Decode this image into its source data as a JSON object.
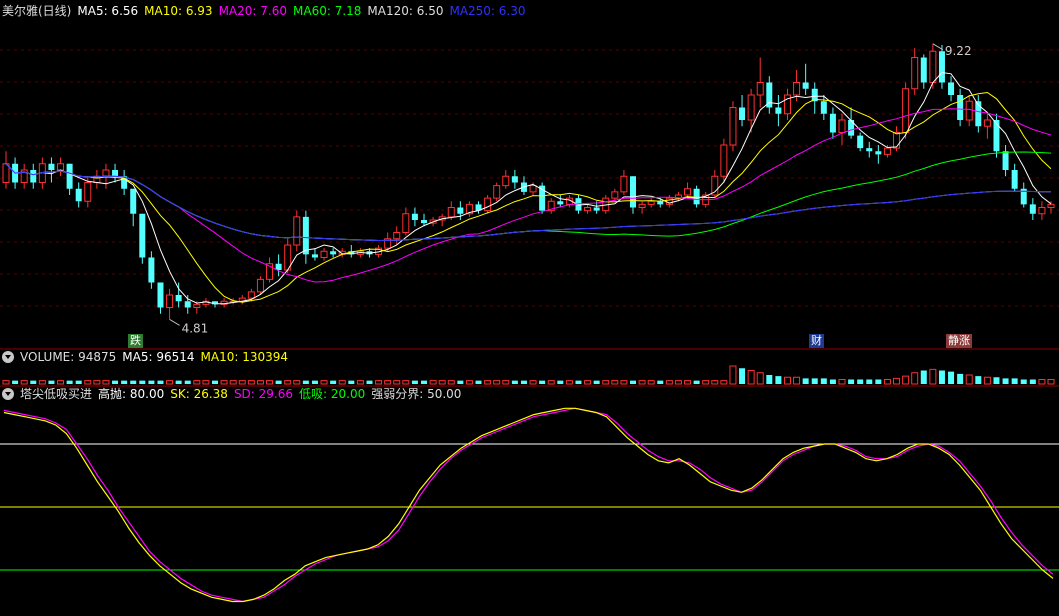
{
  "main": {
    "title": "美尔雅(日线)",
    "ma_labels": [
      {
        "text": "MA5: 6.56",
        "color": "#ffffff"
      },
      {
        "text": "MA10: 6.93",
        "color": "#ffff00"
      },
      {
        "text": "MA20: 7.60",
        "color": "#ff00ff"
      },
      {
        "text": "MA60: 7.18",
        "color": "#00ff00"
      },
      {
        "text": "MA120: 6.50",
        "color": "#dddddd"
      },
      {
        "text": "MA250: 6.30",
        "color": "#3030ff"
      }
    ],
    "high_label": "9.22",
    "low_label": "4.81",
    "tags": [
      {
        "text": "跌",
        "bg": "#2e7d32"
      },
      {
        "text": "财",
        "bg": "#1f3a93"
      },
      {
        "text": "静涨",
        "bg": "#8b3a3a"
      }
    ]
  },
  "volume": {
    "labels": [
      {
        "text": "VOLUME: 94875",
        "color": "#dddddd"
      },
      {
        "text": "MA5: 96514",
        "color": "#ffffff"
      },
      {
        "text": "MA10: 130394",
        "color": "#ffff00"
      }
    ]
  },
  "indicator": {
    "labels": [
      {
        "text": "塔尖低吸买进",
        "color": "#dddddd"
      },
      {
        "text": "高抛: 80.00",
        "color": "#ffffff"
      },
      {
        "text": "SK: 26.38",
        "color": "#ffff00"
      },
      {
        "text": "SD: 29.66",
        "color": "#ff00ff"
      },
      {
        "text": "低吸: 20.00",
        "color": "#00ff00"
      },
      {
        "text": "强弱分界: 50.00",
        "color": "#dddddd"
      }
    ]
  },
  "chart_data": {
    "type": "candlestick",
    "price_range": [
      4.4,
      9.6
    ],
    "candles": [
      [
        7.0,
        7.5,
        6.9,
        7.3
      ],
      [
        7.3,
        7.4,
        6.9,
        7.0
      ],
      [
        7.0,
        7.3,
        6.9,
        7.2
      ],
      [
        7.2,
        7.3,
        6.9,
        7.0
      ],
      [
        7.0,
        7.4,
        6.9,
        7.3
      ],
      [
        7.3,
        7.4,
        7.0,
        7.2
      ],
      [
        7.2,
        7.4,
        7.1,
        7.3
      ],
      [
        7.3,
        7.3,
        6.8,
        6.9
      ],
      [
        6.9,
        7.0,
        6.6,
        6.7
      ],
      [
        6.7,
        7.1,
        6.6,
        7.0
      ],
      [
        7.0,
        7.2,
        6.9,
        7.1
      ],
      [
        7.1,
        7.3,
        6.9,
        7.2
      ],
      [
        7.2,
        7.3,
        7.0,
        7.1
      ],
      [
        7.1,
        7.2,
        6.8,
        6.9
      ],
      [
        6.9,
        6.9,
        6.3,
        6.5
      ],
      [
        6.5,
        6.5,
        5.7,
        5.8
      ],
      [
        5.8,
        5.9,
        5.3,
        5.4
      ],
      [
        5.4,
        5.4,
        4.9,
        5.0
      ],
      [
        5.0,
        5.3,
        4.81,
        5.2
      ],
      [
        5.2,
        5.4,
        5.0,
        5.1
      ],
      [
        5.1,
        5.2,
        4.9,
        5.0
      ],
      [
        5.0,
        5.1,
        4.9,
        5.05
      ],
      [
        5.05,
        5.15,
        5.0,
        5.1
      ],
      [
        5.1,
        5.1,
        5.0,
        5.05
      ],
      [
        5.05,
        5.15,
        5.0,
        5.1
      ],
      [
        5.1,
        5.15,
        5.05,
        5.1
      ],
      [
        5.1,
        5.2,
        5.05,
        5.15
      ],
      [
        5.15,
        5.3,
        5.1,
        5.25
      ],
      [
        5.25,
        5.5,
        5.2,
        5.45
      ],
      [
        5.45,
        5.8,
        5.4,
        5.7
      ],
      [
        5.7,
        5.85,
        5.5,
        5.6
      ],
      [
        5.6,
        6.1,
        5.55,
        6.0
      ],
      [
        6.0,
        6.55,
        5.9,
        6.45
      ],
      [
        6.45,
        6.55,
        5.7,
        5.85
      ],
      [
        5.85,
        5.95,
        5.75,
        5.8
      ],
      [
        5.8,
        5.95,
        5.75,
        5.9
      ],
      [
        5.9,
        5.95,
        5.8,
        5.85
      ],
      [
        5.85,
        5.95,
        5.8,
        5.9
      ],
      [
        5.9,
        6.0,
        5.8,
        5.85
      ],
      [
        5.85,
        5.95,
        5.8,
        5.9
      ],
      [
        5.9,
        5.95,
        5.8,
        5.85
      ],
      [
        5.85,
        6.0,
        5.8,
        5.95
      ],
      [
        5.95,
        6.2,
        5.9,
        6.1
      ],
      [
        6.1,
        6.3,
        6.0,
        6.2
      ],
      [
        6.2,
        6.6,
        6.15,
        6.5
      ],
      [
        6.5,
        6.6,
        6.3,
        6.4
      ],
      [
        6.4,
        6.5,
        6.3,
        6.35
      ],
      [
        6.35,
        6.45,
        6.3,
        6.4
      ],
      [
        6.4,
        6.5,
        6.3,
        6.45
      ],
      [
        6.45,
        6.7,
        6.4,
        6.6
      ],
      [
        6.6,
        6.7,
        6.4,
        6.5
      ],
      [
        6.5,
        6.7,
        6.45,
        6.65
      ],
      [
        6.65,
        6.7,
        6.5,
        6.55
      ],
      [
        6.55,
        6.8,
        6.5,
        6.75
      ],
      [
        6.75,
        7.0,
        6.7,
        6.95
      ],
      [
        6.95,
        7.2,
        6.9,
        7.1
      ],
      [
        7.1,
        7.2,
        6.9,
        7.0
      ],
      [
        7.0,
        7.1,
        6.8,
        6.85
      ],
      [
        6.85,
        7.0,
        6.8,
        6.95
      ],
      [
        6.95,
        7.0,
        6.5,
        6.55
      ],
      [
        6.55,
        6.75,
        6.5,
        6.7
      ],
      [
        6.7,
        6.8,
        6.6,
        6.65
      ],
      [
        6.65,
        6.8,
        6.6,
        6.75
      ],
      [
        6.75,
        6.8,
        6.5,
        6.55
      ],
      [
        6.55,
        6.65,
        6.5,
        6.6
      ],
      [
        6.6,
        6.7,
        6.5,
        6.55
      ],
      [
        6.55,
        6.8,
        6.5,
        6.75
      ],
      [
        6.75,
        6.9,
        6.7,
        6.85
      ],
      [
        6.85,
        7.2,
        6.8,
        7.1
      ],
      [
        7.1,
        7.1,
        6.5,
        6.6
      ],
      [
        6.6,
        6.7,
        6.5,
        6.65
      ],
      [
        6.65,
        6.75,
        6.6,
        6.7
      ],
      [
        6.7,
        6.75,
        6.6,
        6.65
      ],
      [
        6.65,
        6.8,
        6.6,
        6.75
      ],
      [
        6.75,
        6.85,
        6.7,
        6.8
      ],
      [
        6.8,
        7.0,
        6.75,
        6.9
      ],
      [
        6.9,
        6.95,
        6.6,
        6.65
      ],
      [
        6.65,
        6.85,
        6.6,
        6.8
      ],
      [
        6.8,
        7.2,
        6.75,
        7.1
      ],
      [
        7.1,
        7.7,
        7.0,
        7.6
      ],
      [
        7.6,
        8.3,
        7.5,
        8.2
      ],
      [
        8.2,
        8.4,
        7.9,
        8.0
      ],
      [
        8.0,
        8.5,
        7.8,
        8.4
      ],
      [
        8.4,
        9.0,
        8.2,
        8.6
      ],
      [
        8.6,
        8.7,
        8.1,
        8.2
      ],
      [
        8.2,
        8.4,
        7.9,
        8.1
      ],
      [
        8.1,
        8.5,
        8.0,
        8.4
      ],
      [
        8.4,
        8.8,
        8.3,
        8.6
      ],
      [
        8.6,
        8.9,
        8.4,
        8.5
      ],
      [
        8.5,
        8.6,
        8.1,
        8.3
      ],
      [
        8.3,
        8.4,
        8.0,
        8.1
      ],
      [
        8.1,
        8.2,
        7.7,
        7.8
      ],
      [
        7.8,
        8.1,
        7.6,
        8.0
      ],
      [
        8.0,
        8.2,
        7.7,
        7.75
      ],
      [
        7.75,
        7.8,
        7.5,
        7.55
      ],
      [
        7.55,
        7.65,
        7.4,
        7.5
      ],
      [
        7.5,
        7.6,
        7.3,
        7.45
      ],
      [
        7.45,
        7.6,
        7.4,
        7.55
      ],
      [
        7.55,
        7.9,
        7.5,
        7.8
      ],
      [
        7.8,
        8.6,
        7.7,
        8.5
      ],
      [
        8.5,
        9.15,
        8.4,
        9.0
      ],
      [
        9.0,
        9.05,
        8.5,
        8.6
      ],
      [
        8.6,
        9.22,
        8.5,
        9.1
      ],
      [
        9.1,
        9.2,
        8.5,
        8.6
      ],
      [
        8.6,
        8.7,
        8.3,
        8.4
      ],
      [
        8.4,
        8.5,
        7.9,
        8.0
      ],
      [
        8.0,
        8.4,
        7.9,
        8.3
      ],
      [
        8.3,
        8.4,
        7.8,
        7.9
      ],
      [
        7.9,
        8.1,
        7.7,
        8.0
      ],
      [
        8.0,
        8.1,
        7.4,
        7.5
      ],
      [
        7.5,
        7.6,
        7.1,
        7.2
      ],
      [
        7.2,
        7.3,
        6.85,
        6.9
      ],
      [
        6.9,
        7.0,
        6.6,
        6.65
      ],
      [
        6.65,
        6.75,
        6.4,
        6.5
      ],
      [
        6.5,
        6.7,
        6.4,
        6.6
      ],
      [
        6.6,
        6.7,
        6.5,
        6.65
      ]
    ],
    "volume": [
      3,
      3,
      3,
      3,
      3,
      3,
      3,
      3,
      3,
      3,
      3,
      3,
      3,
      3,
      3,
      3,
      3,
      3,
      3,
      3,
      3,
      3,
      3,
      3,
      3,
      3,
      3,
      3,
      3,
      3,
      3,
      3,
      3,
      3,
      3,
      3,
      3,
      3,
      3,
      3,
      3,
      3,
      3,
      3,
      3,
      3,
      3,
      3,
      3,
      3,
      3,
      3,
      3,
      3,
      3,
      3,
      3,
      3,
      3,
      3,
      3,
      3,
      3,
      3,
      3,
      3,
      3,
      3,
      3,
      3,
      3,
      3,
      3,
      3,
      3,
      3,
      3,
      3,
      3,
      3,
      16,
      14,
      12,
      10,
      8,
      7,
      6,
      6,
      5,
      5,
      5,
      4,
      4,
      4,
      4,
      4,
      4,
      4,
      5,
      7,
      10,
      12,
      13,
      12,
      11,
      9,
      8,
      7,
      6,
      6,
      5,
      5,
      4,
      4,
      4,
      4,
      4,
      3
    ],
    "indicator": {
      "high": 80,
      "low": 20,
      "mid": 50,
      "sk": [
        95,
        94,
        93,
        92,
        91,
        89,
        85,
        78,
        70,
        62,
        55,
        48,
        40,
        33,
        27,
        22,
        18,
        14,
        11,
        9,
        7,
        6,
        5,
        5,
        6,
        8,
        11,
        15,
        18,
        22,
        24,
        26,
        27,
        28,
        29,
        30,
        32,
        36,
        42,
        50,
        58,
        64,
        70,
        74,
        78,
        81,
        84,
        86,
        88,
        90,
        92,
        94,
        95,
        96,
        97,
        97,
        96,
        95,
        93,
        88,
        83,
        79,
        75,
        72,
        71,
        73,
        70,
        66,
        62,
        60,
        58,
        57,
        59,
        63,
        68,
        73,
        76,
        78,
        79,
        80,
        80,
        78,
        76,
        73,
        72,
        73,
        75,
        78,
        80,
        80,
        78,
        75,
        70,
        64,
        58,
        50,
        42,
        35,
        30,
        25,
        20,
        16
      ],
      "sd": [
        96,
        95,
        94,
        93,
        92,
        90,
        87,
        80,
        73,
        65,
        58,
        50,
        43,
        36,
        29,
        24,
        20,
        16,
        13,
        10,
        8,
        7,
        6,
        5,
        6,
        7,
        10,
        13,
        17,
        20,
        23,
        25,
        27,
        28,
        29,
        30,
        31,
        34,
        39,
        47,
        55,
        62,
        68,
        73,
        77,
        80,
        83,
        85,
        87,
        89,
        91,
        93,
        94,
        95,
        96,
        97,
        96,
        95,
        94,
        90,
        85,
        81,
        77,
        74,
        72,
        72,
        71,
        68,
        64,
        61,
        59,
        57,
        58,
        62,
        67,
        72,
        75,
        77,
        79,
        80,
        80,
        79,
        77,
        74,
        73,
        73,
        74,
        77,
        79,
        80,
        79,
        76,
        72,
        66,
        60,
        53,
        45,
        38,
        32,
        27,
        22,
        18
      ]
    }
  }
}
